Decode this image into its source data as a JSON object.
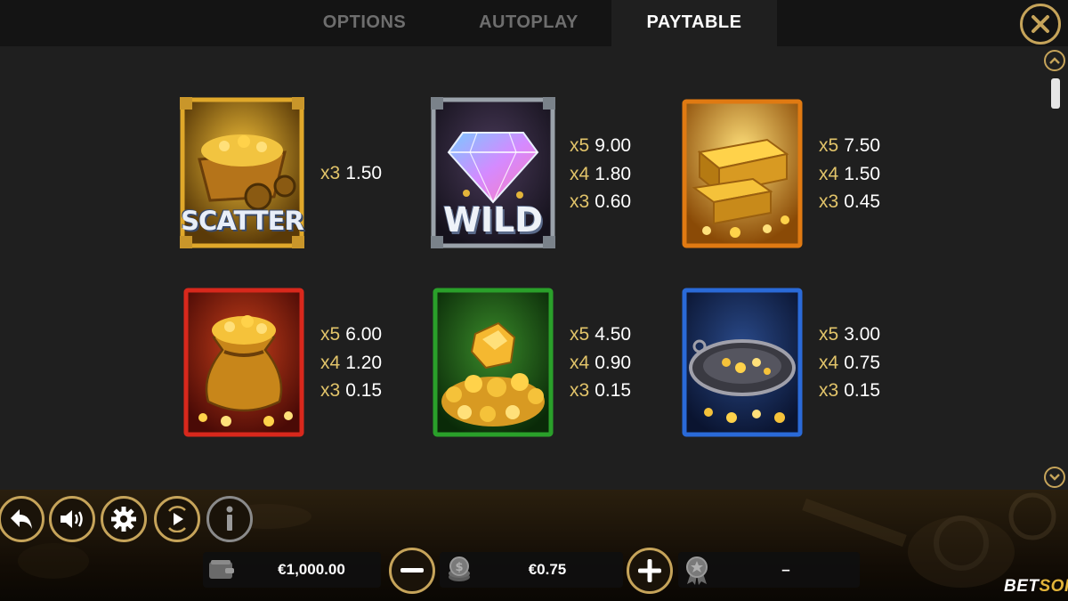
{
  "tabs": [
    {
      "label": "OPTIONS",
      "active": false
    },
    {
      "label": "AUTOPLAY",
      "active": false
    },
    {
      "label": "PAYTABLE",
      "active": true
    }
  ],
  "icons": {
    "close": "close-icon",
    "scroll_up": "chevron-up-icon",
    "scroll_down": "chevron-down-icon"
  },
  "paytable": {
    "symbols": [
      {
        "name": "scatter",
        "label": "SCATTER",
        "frame_color": "#d9a21c",
        "pays": [
          {
            "mult": "x3",
            "value": "1.50"
          }
        ]
      },
      {
        "name": "wild",
        "label": "WILD",
        "frame_color": "#9aa2aa",
        "pays": [
          {
            "mult": "x5",
            "value": "9.00"
          },
          {
            "mult": "x4",
            "value": "1.80"
          },
          {
            "mult": "x3",
            "value": "0.60"
          }
        ]
      },
      {
        "name": "gold-bars",
        "label": "",
        "frame_color": "#e07a12",
        "pays": [
          {
            "mult": "x5",
            "value": "7.50"
          },
          {
            "mult": "x4",
            "value": "1.50"
          },
          {
            "mult": "x3",
            "value": "0.45"
          }
        ]
      },
      {
        "name": "gold-sack",
        "label": "",
        "frame_color": "#d8281c",
        "pays": [
          {
            "mult": "x5",
            "value": "6.00"
          },
          {
            "mult": "x4",
            "value": "1.20"
          },
          {
            "mult": "x3",
            "value": "0.15"
          }
        ]
      },
      {
        "name": "gold-nugget",
        "label": "",
        "frame_color": "#2aa02a",
        "pays": [
          {
            "mult": "x5",
            "value": "4.50"
          },
          {
            "mult": "x4",
            "value": "0.90"
          },
          {
            "mult": "x3",
            "value": "0.15"
          }
        ]
      },
      {
        "name": "gold-pan",
        "label": "",
        "frame_color": "#2a6ad8",
        "pays": [
          {
            "mult": "x5",
            "value": "3.00"
          },
          {
            "mult": "x4",
            "value": "0.75"
          },
          {
            "mult": "x3",
            "value": "0.15"
          }
        ]
      }
    ]
  },
  "controls": {
    "buttons": [
      "back-icon",
      "sound-icon",
      "settings-icon",
      "autoplay-icon",
      "info-icon"
    ]
  },
  "status": {
    "balance": "€1,000.00",
    "bet": "€0.75",
    "win": "–"
  },
  "brand": {
    "part1": "BET",
    "part2": "SOFT"
  },
  "colors": {
    "accent": "#c6a45a",
    "multiplier": "#e2c46a",
    "background": "#1f1f1f"
  }
}
